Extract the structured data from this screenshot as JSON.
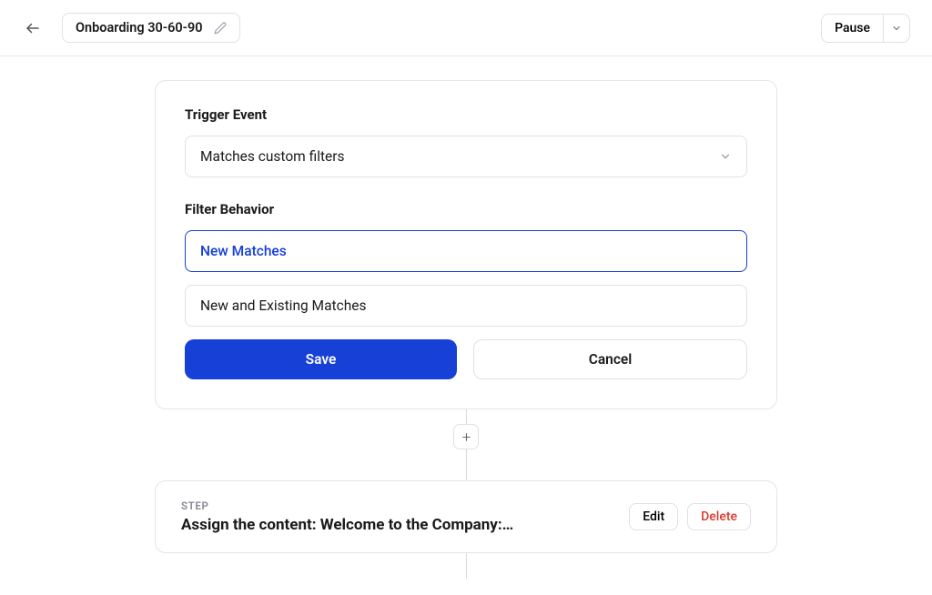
{
  "header": {
    "title": "Onboarding 30-60-90",
    "pause_label": "Pause"
  },
  "trigger_card": {
    "trigger_event_label": "Trigger Event",
    "trigger_event_value": "Matches custom filters",
    "filter_behavior_label": "Filter Behavior",
    "options": {
      "new_matches": "New Matches",
      "new_existing_matches": "New and Existing Matches"
    },
    "save_label": "Save",
    "cancel_label": "Cancel"
  },
  "step_card": {
    "eyebrow": "STEP",
    "title": "Assign the content: Welcome to the Company:…",
    "edit_label": "Edit",
    "delete_label": "Delete"
  }
}
